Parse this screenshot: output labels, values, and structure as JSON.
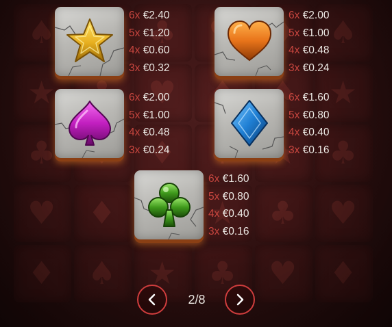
{
  "paytable": [
    {
      "symbol": "star-icon",
      "color": "#e8b020",
      "payouts": [
        {
          "mult": "6x",
          "amount": "€2.40"
        },
        {
          "mult": "5x",
          "amount": "€1.20"
        },
        {
          "mult": "4x",
          "amount": "€0.60"
        },
        {
          "mult": "3x",
          "amount": "€0.32"
        }
      ]
    },
    {
      "symbol": "heart-icon",
      "color": "#e8741a",
      "payouts": [
        {
          "mult": "6x",
          "amount": "€2.00"
        },
        {
          "mult": "5x",
          "amount": "€1.00"
        },
        {
          "mult": "4x",
          "amount": "€0.48"
        },
        {
          "mult": "3x",
          "amount": "€0.24"
        }
      ]
    },
    {
      "symbol": "spade-icon",
      "color": "#c21fc0",
      "payouts": [
        {
          "mult": "6x",
          "amount": "€2.00"
        },
        {
          "mult": "5x",
          "amount": "€1.00"
        },
        {
          "mult": "4x",
          "amount": "€0.48"
        },
        {
          "mult": "3x",
          "amount": "€0.24"
        }
      ]
    },
    {
      "symbol": "diamond-icon",
      "color": "#1f7fd4",
      "payouts": [
        {
          "mult": "6x",
          "amount": "€1.60"
        },
        {
          "mult": "5x",
          "amount": "€0.80"
        },
        {
          "mult": "4x",
          "amount": "€0.40"
        },
        {
          "mult": "3x",
          "amount": "€0.16"
        }
      ]
    },
    {
      "symbol": "club-icon",
      "color": "#3f9a1c",
      "payouts": [
        {
          "mult": "6x",
          "amount": "€1.60"
        },
        {
          "mult": "5x",
          "amount": "€0.80"
        },
        {
          "mult": "4x",
          "amount": "€0.40"
        },
        {
          "mult": "3x",
          "amount": "€0.16"
        }
      ]
    }
  ],
  "pagination": {
    "current_page": 2,
    "total_pages": 8,
    "label": "2/8",
    "prev_icon": "chevron-left-icon",
    "next_icon": "chevron-right-icon"
  },
  "colors": {
    "multiplier_text": "#c8463f",
    "amount_text": "#ece9e4",
    "nav_border": "#cf3d3d",
    "background": "#2e1010"
  }
}
